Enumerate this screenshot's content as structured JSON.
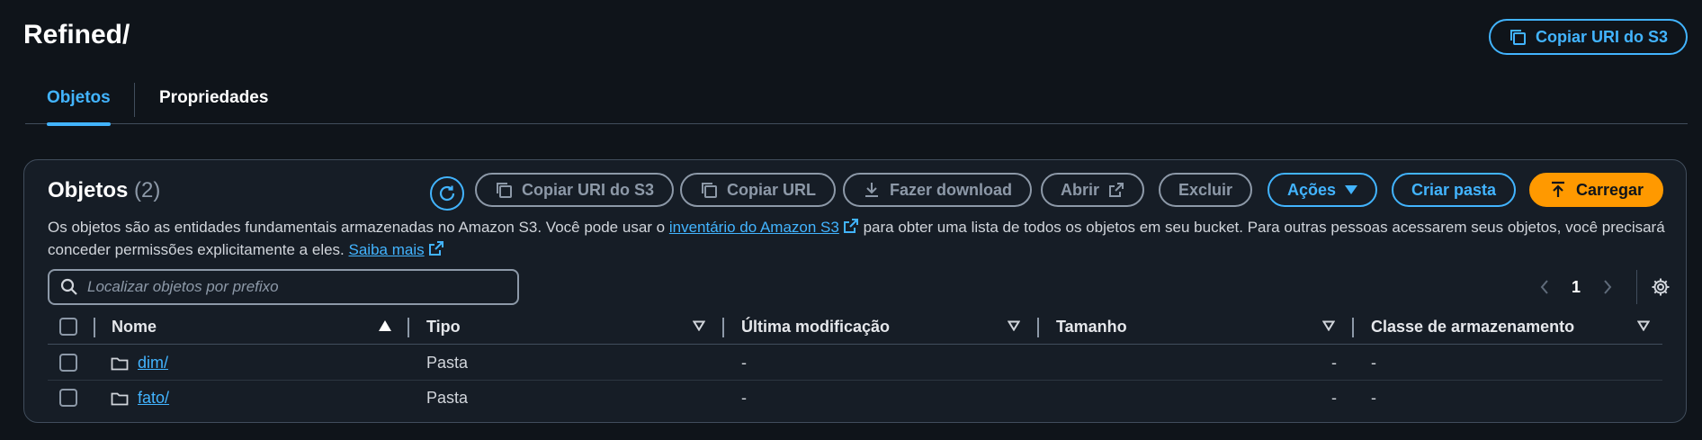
{
  "page": {
    "title": "Refined/",
    "copy_uri_label": "Copiar URI do S3"
  },
  "tabs": [
    {
      "label": "Objetos"
    },
    {
      "label": "Propriedades"
    }
  ],
  "panel": {
    "title": "Objetos",
    "count": "(2)",
    "description": {
      "part1": "Os objetos são as entidades fundamentais armazenadas no Amazon S3. Você pode usar o ",
      "link1": "inventário do Amazon S3",
      "part2": " para obter uma lista de todos os objetos em seu bucket. Para outras pessoas acessarem seus objetos, você precisará conceder permissões explicitamente a eles. ",
      "link2": "Saiba mais"
    },
    "toolbar": {
      "copy_uri": "Copiar URI do S3",
      "copy_url": "Copiar URL",
      "download": "Fazer download",
      "open": "Abrir",
      "delete": "Excluir",
      "actions": "Ações",
      "create_folder": "Criar pasta",
      "upload": "Carregar"
    },
    "search_placeholder": "Localizar objetos por prefixo",
    "pagination": {
      "current_page": "1"
    },
    "columns": [
      "Nome",
      "Tipo",
      "Última modificação",
      "Tamanho",
      "Classe de armazenamento"
    ],
    "rows": [
      {
        "name": "dim/",
        "type": "Pasta",
        "modified": "-",
        "size": "-",
        "storage_class": "-"
      },
      {
        "name": "fato/",
        "type": "Pasta",
        "modified": "-",
        "size": "-",
        "storage_class": "-"
      }
    ]
  },
  "colors": {
    "background": "#0f141a",
    "panel": "#161d26",
    "accent": "#42b4ff",
    "primary_button": "#ff9900",
    "border": "#414d5c"
  }
}
